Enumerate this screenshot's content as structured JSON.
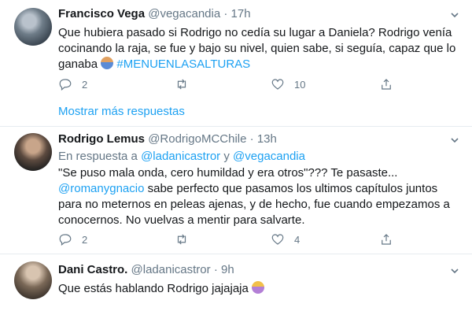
{
  "tweets": [
    {
      "name": "Francisco Vega",
      "handle": "@vegacandia",
      "sep": "·",
      "time": "17h",
      "text_plain": "Que hubiera pasado si Rodrigo no cedía su lugar a Daniela? Rodrigo venía cocinando la raja, se fue y bajo su nivel, quien sabe, si seguía, capaz que lo ganaba ",
      "hashtag": "#MENUENLASALTURAS",
      "emoji_icon": "man-gesturing-icon",
      "replies": "2",
      "likes": "10"
    },
    {
      "name": "Rodrigo Lemus",
      "handle": "@RodrigoMCChile",
      "sep": "·",
      "time": "13h",
      "reply_prefix": "En respuesta a ",
      "reply_to_1": "@ladanicastror",
      "reply_and": " y ",
      "reply_to_2": "@vegacandia",
      "text_1": "\"Se puso mala onda, cero humildad y era otros\"??? Te pasaste...",
      "mention": "@romanygnacio",
      "text_2": " sabe perfecto que pasamos los ultimos capítulos juntos para no meternos en peleas ajenas, y de hecho, fue cuando empezamos a conocernos. No vuelvas a mentir para salvarte.",
      "replies": "2",
      "likes": "4"
    },
    {
      "name": "Dani Castro.",
      "handle": "@ladanicastror",
      "sep": "·",
      "time": "9h",
      "text": "Que estás hablando Rodrigo jajajaja ",
      "emoji_icon": "woman-facepalming-icon"
    }
  ],
  "more_replies_label": "Mostrar más respuestas",
  "colors": {
    "link": "#1da1f2",
    "muted": "#657786",
    "divider": "#e6ecf0"
  }
}
